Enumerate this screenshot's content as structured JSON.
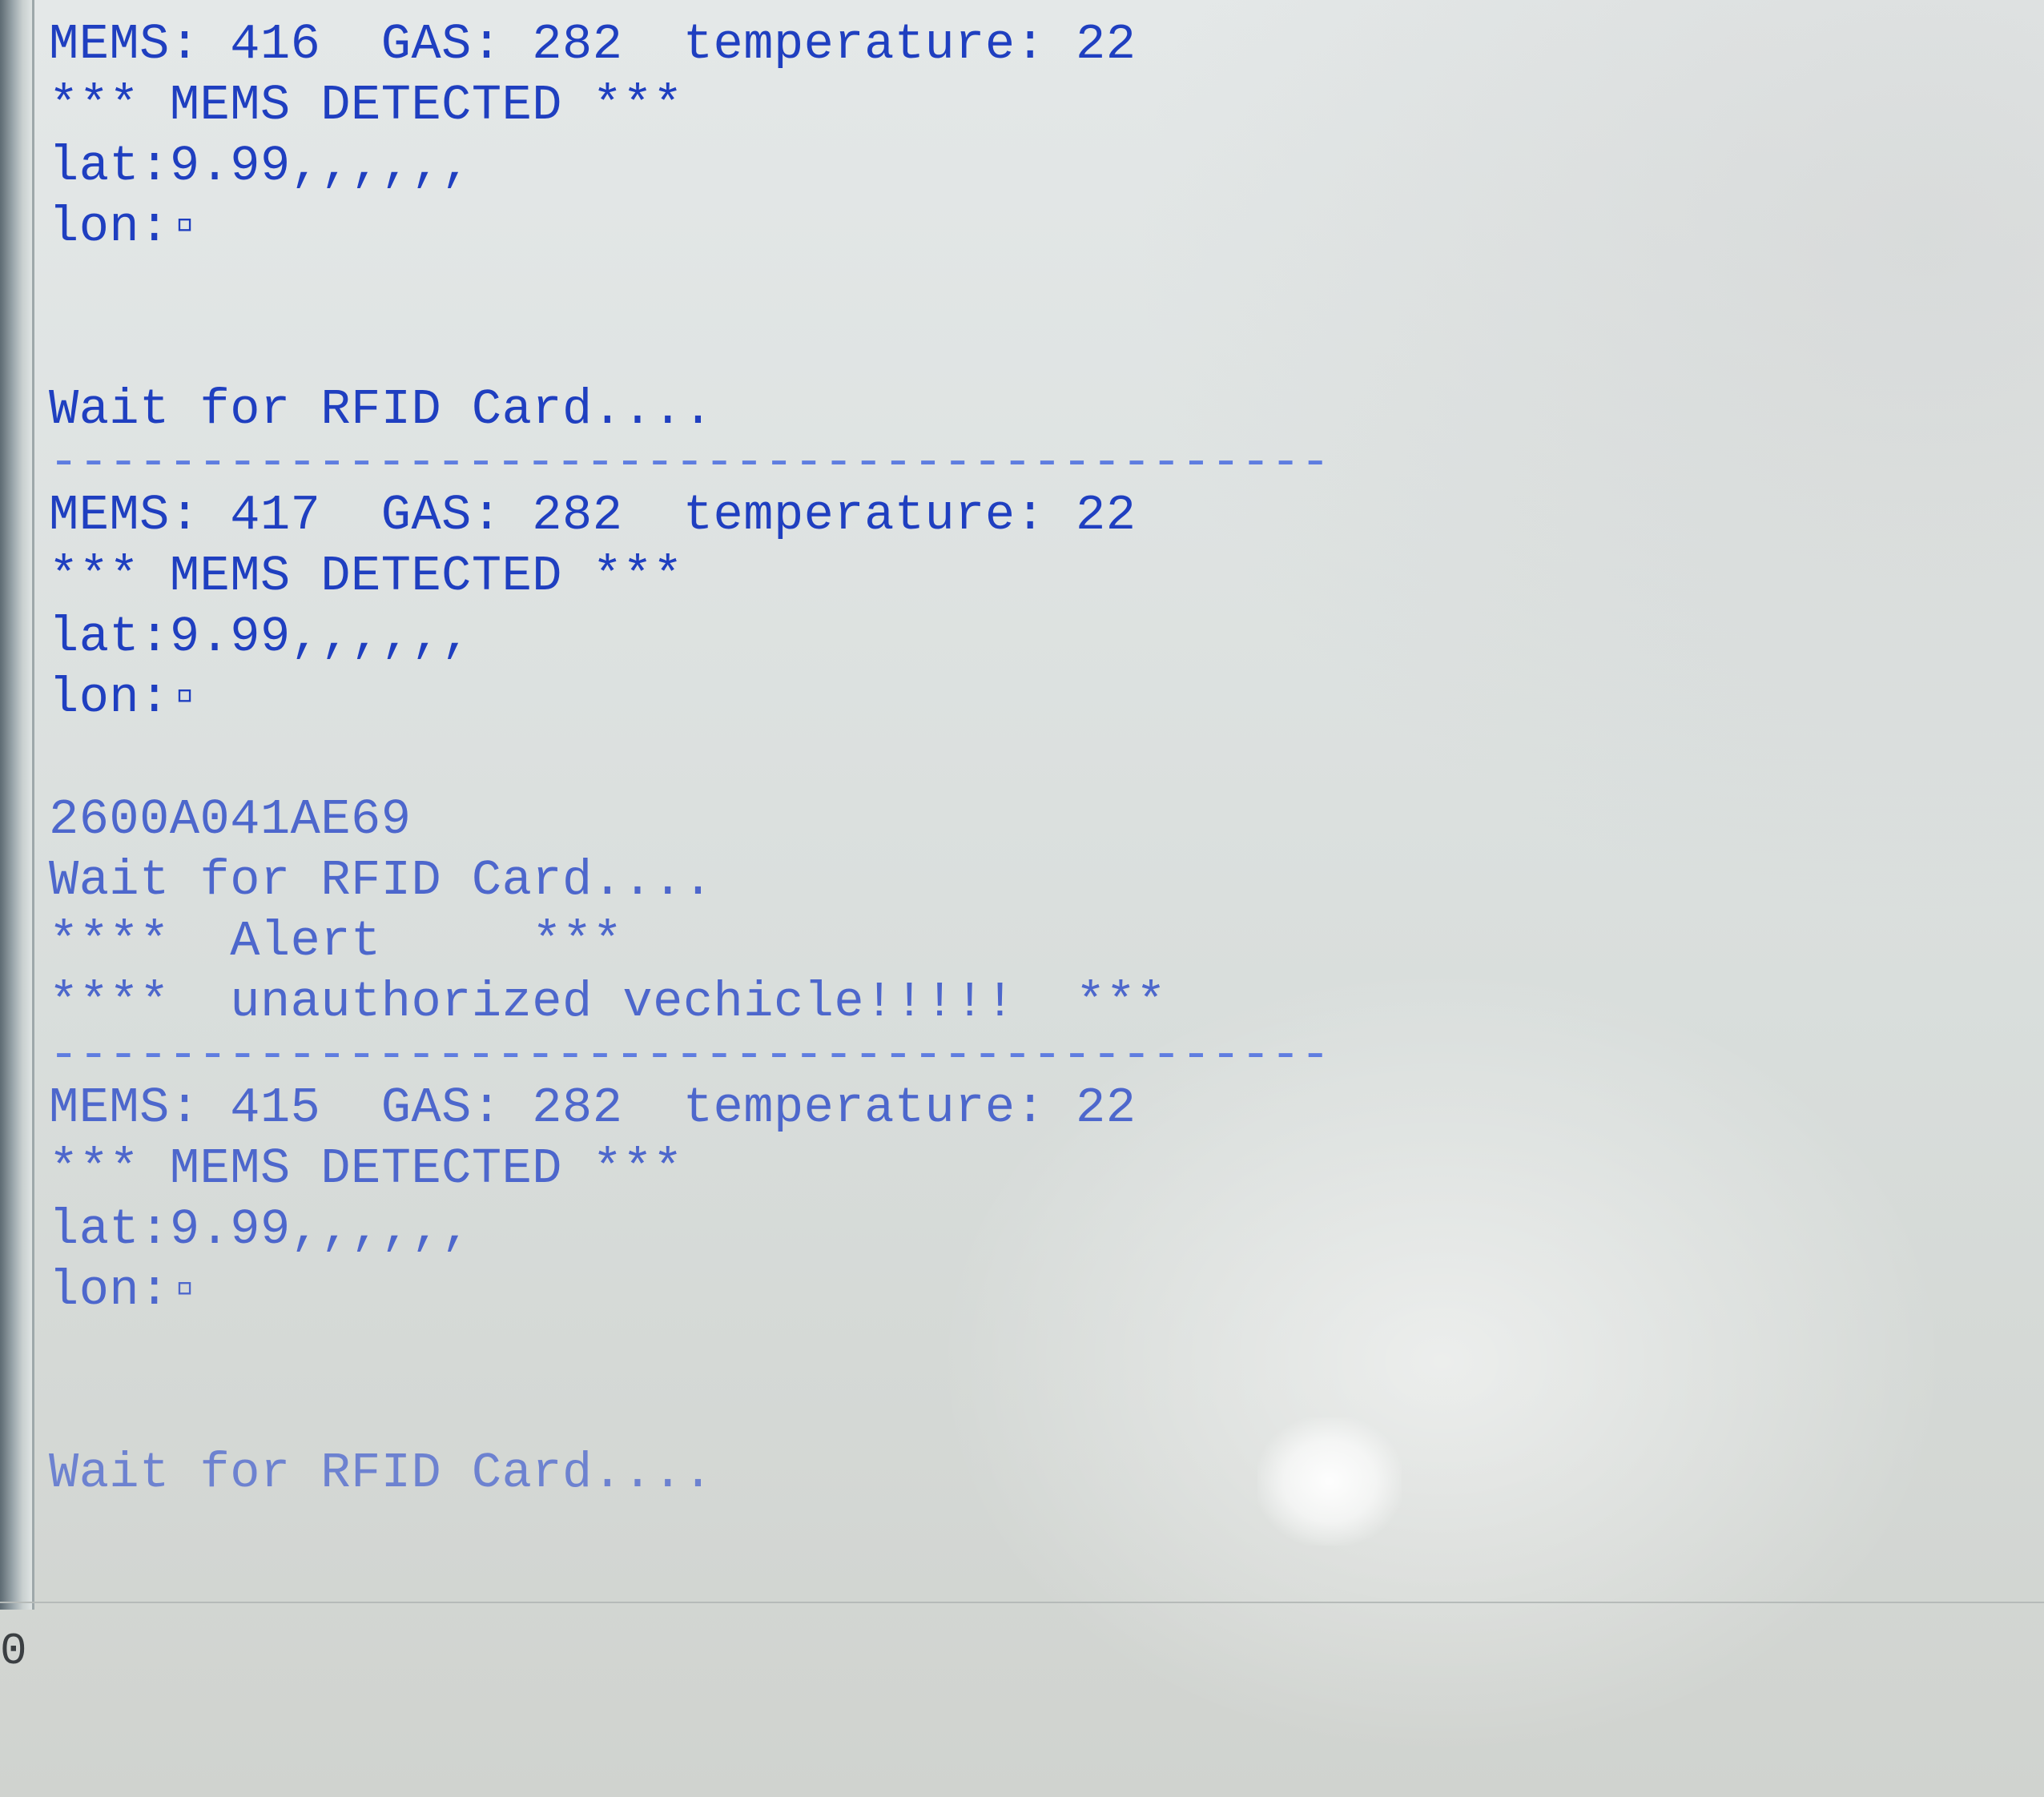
{
  "colors": {
    "console_text": "#1f3fc0",
    "separator": "#5f7de0",
    "background": "#dfe3e2"
  },
  "console": {
    "lines": [
      "MEMS: 416  GAS: 282  temperature: 22",
      "*** MEMS DETECTED ***",
      "lat:9.99,,,,,,",
      "lon:▫",
      "",
      "",
      "Wait for RFID Card....",
      "-------------------------------------------",
      "MEMS: 417  GAS: 282  temperature: 22",
      "*** MEMS DETECTED ***",
      "lat:9.99,,,,,,",
      "lon:▫",
      "",
      "2600A041AE69",
      "Wait for RFID Card....",
      "****  Alert     ***",
      "****  unauthorized vechicle!!!!!  ***",
      "-------------------------------------------",
      "MEMS: 415  GAS: 282  temperature: 22",
      "*** MEMS DETECTED ***",
      "lat:9.99,,,,,,",
      "lon:▫",
      "",
      "",
      "Wait for RFID Card...."
    ]
  },
  "status": {
    "corner_value": "0"
  }
}
